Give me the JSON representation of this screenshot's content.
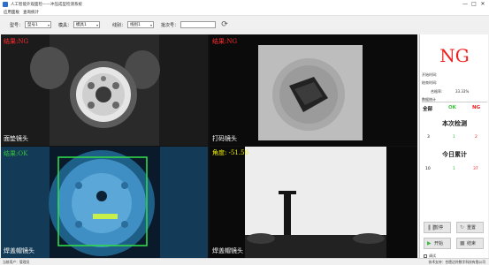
{
  "window": {
    "title": "人工智能外观面检——冲压成型检测系统",
    "controls": [
      "—",
      "□",
      "✕"
    ]
  },
  "menu": [
    "应用面板",
    "查询统计"
  ],
  "toolbar": {
    "model_label": "型号：",
    "model_value": "型号1",
    "mold_label": "模具：",
    "mold_value": "模具1",
    "line_label": "线别：",
    "line_value": "线别1",
    "batch_label": "批次号：",
    "batch_value": ""
  },
  "cameras": [
    {
      "result": "结果:NG",
      "result_status": "NG",
      "name": "面垫镜头"
    },
    {
      "result": "结果:NG",
      "result_status": "NG",
      "name": "打码镜头"
    },
    {
      "result": "结果:OK",
      "result_status": "OK",
      "name": "焊盖帽镜头"
    },
    {
      "angle": "角度: -51.56",
      "name": "焊盖帽镜头"
    }
  ],
  "panel": {
    "result_big": "NG",
    "start_time_label": "开始时间:",
    "end_time_label": "结束时间:",
    "pass_rate_label": "合格率:",
    "pass_rate_value": "33.33%",
    "data_stats_label": "数据统计",
    "header_all": "全部",
    "header_ok": "OK",
    "header_ng": "NG",
    "this_inspection_title": "本次检测",
    "this_inspection": {
      "all": "3",
      "ok": "1",
      "ng": "2"
    },
    "today_total_title": "今日累计",
    "today_total": {
      "all": "10",
      "ok": "1",
      "ng": "37"
    }
  },
  "buttons": {
    "pause": "暂停",
    "reset": "重置",
    "start": "开始",
    "end": "结束",
    "mode": "调试"
  },
  "statusbar": {
    "user": "当前用户：管理员",
    "support": "技术支持：合肥达朴数字科技有限公司"
  },
  "colors": {
    "ng_red": "#ef1f1f",
    "ok_green": "#37c23a",
    "angle_yellow": "#f2f200",
    "cell_divider_blue": "#1c3fd6"
  }
}
